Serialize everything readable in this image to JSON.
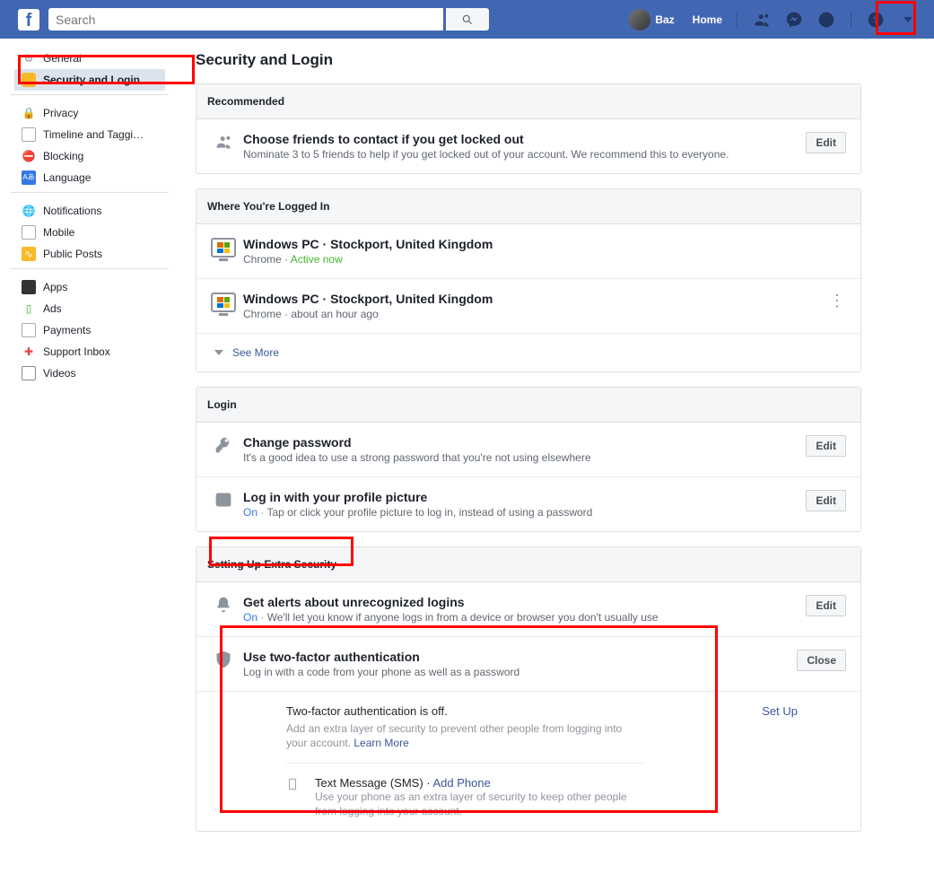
{
  "search": {
    "placeholder": "Search"
  },
  "topbar": {
    "user_name": "Baz",
    "home": "Home"
  },
  "sidebar": {
    "group1": [
      {
        "label": "General"
      },
      {
        "label": "Security and Login"
      }
    ],
    "group2": [
      {
        "label": "Privacy"
      },
      {
        "label": "Timeline and Taggi…"
      },
      {
        "label": "Blocking"
      },
      {
        "label": "Language"
      }
    ],
    "group3": [
      {
        "label": "Notifications"
      },
      {
        "label": "Mobile"
      },
      {
        "label": "Public Posts"
      }
    ],
    "group4": [
      {
        "label": "Apps"
      },
      {
        "label": "Ads"
      },
      {
        "label": "Payments"
      },
      {
        "label": "Support Inbox"
      },
      {
        "label": "Videos"
      }
    ]
  },
  "page": {
    "title": "Security and Login"
  },
  "recommended": {
    "header": "Recommended",
    "friends_title": "Choose friends to contact if you get locked out",
    "friends_sub": "Nominate 3 to 5 friends to help if you get locked out of your account. We recommend this to everyone.",
    "edit": "Edit"
  },
  "sessions": {
    "header": "Where You're Logged In",
    "items": [
      {
        "title": "Windows PC · Stockport, United Kingdom",
        "browser": "Chrome",
        "when": "Active now",
        "active": true
      },
      {
        "title": "Windows PC · Stockport, United Kingdom",
        "browser": "Chrome",
        "when": "about an hour ago",
        "active": false
      }
    ],
    "see_more": "See More"
  },
  "login_section": {
    "header": "Login",
    "pw_title": "Change password",
    "pw_sub": "It's a good idea to use a strong password that you're not using elsewhere",
    "pic_title": "Log in with your profile picture",
    "pic_on": "On",
    "pic_sub": "Tap or click your profile picture to log in, instead of using a password",
    "edit": "Edit"
  },
  "extra": {
    "header": "Setting Up Extra Security",
    "alerts_title": "Get alerts about unrecognized logins",
    "alerts_on": "On",
    "alerts_sub": "We'll let you know if anyone logs in from a device or browser you don't usually use",
    "twofa_title": "Use two-factor authentication",
    "twofa_sub": "Log in with a code from your phone as well as a password",
    "twofa_status": "Two-factor authentication is off.",
    "twofa_desc": "Add an extra layer of security to prevent other people from logging into your account. ",
    "learn_more": "Learn More",
    "setup": "Set Up",
    "sms_title": "Text Message (SMS)",
    "sms_add": "Add Phone",
    "sms_desc": "Use your phone as an extra layer of security to keep other people from logging into your account.",
    "edit": "Edit",
    "close": "Close"
  }
}
